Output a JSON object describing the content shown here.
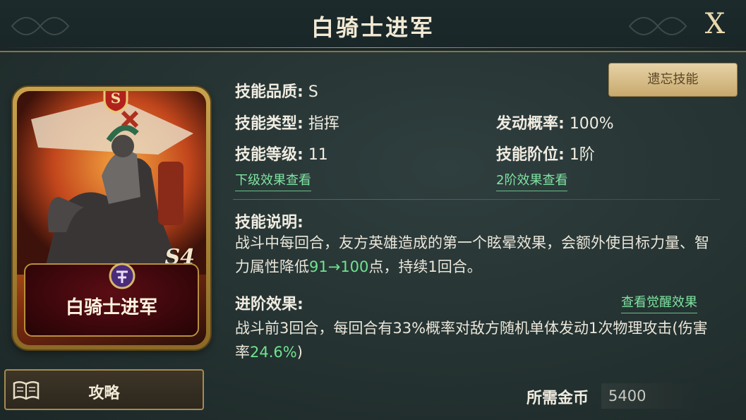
{
  "header": {
    "title": "白骑士进军",
    "close_label": "X"
  },
  "card": {
    "name": "白骑士进军",
    "rank": "S",
    "level_mark": "S4"
  },
  "guide_button": {
    "label": "攻略"
  },
  "skill": {
    "quality_label": "技能品质:",
    "quality_value": "S",
    "type_label": "技能类型:",
    "type_value": "指挥",
    "level_label": "技能等级:",
    "level_value": "11",
    "rate_label": "发动概率:",
    "rate_value": "100%",
    "tier_label": "技能阶位:",
    "tier_value": "1阶",
    "next_level_link": "下级效果查看",
    "tier2_link": "2阶效果查看",
    "forget_button": "遗忘技能"
  },
  "description": {
    "label": "技能说明:",
    "text_part1": "战斗中每回合，友方英雄造成的第一个眩晕效果，会额外使目标力量、智力属性降低",
    "highlight": "91→100",
    "text_part2": "点，持续1回合。"
  },
  "advanced": {
    "label": "进阶效果:",
    "awaken_link": "查看觉醒效果",
    "text_part1": "战斗前3回合，每回合有33%概率对敌方随机单体发动1次物理攻击(伤害率",
    "highlight": "24.6%",
    "text_part2": ")"
  },
  "cost": {
    "label": "所需金币",
    "value": "5400"
  },
  "colors": {
    "accent_green": "#6fe38f",
    "gold": "#c8a96d",
    "background": "#243231"
  }
}
